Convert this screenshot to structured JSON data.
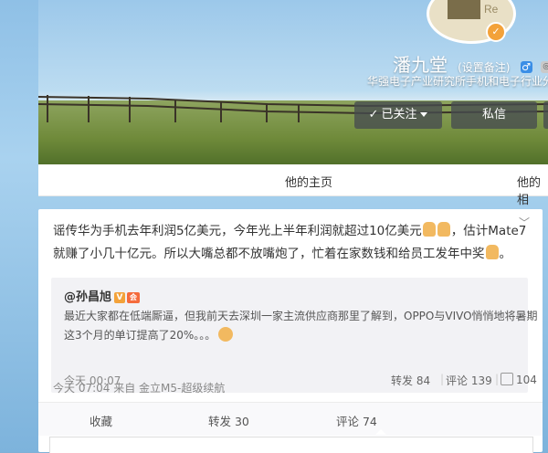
{
  "profile": {
    "avatar_text": "Re",
    "name": "潘九堂",
    "remark": "(设置备注)",
    "gender_icon": "♂",
    "subtitle": "华强电子产业研究所手机和电子行业分析师",
    "follow_label": "已关注",
    "message_label": "私信"
  },
  "nav": {
    "home": "他的主页",
    "second": "他的相"
  },
  "post": {
    "text_part1": "谣传华为手机去年利润5亿美元，今年光上半年利润就超过10亿美元",
    "text_part2": "，估计Mate7就赚了小几十亿元。所以大嘴总都不放嘴炮了，忙着在家数钱和给员工发年中奖",
    "text_part3": "。",
    "meta": "今天 07:04 来自 金立M5-超级续航",
    "quote": {
      "author": "@孙昌旭",
      "text": "最近大家都在低端厮逼，但我前天去深圳一家主流供应商那里了解到，OPPO与VIVO悄悄地将暑期这3个月的单订提高了20%。。。",
      "time": "今天 00:07",
      "repost": "转发 84",
      "comment": "评论 139",
      "like": "104"
    },
    "actions": {
      "collect": "收藏",
      "repost": "转发 30",
      "comment": "评论 74"
    }
  },
  "colors": {
    "accent_orange": "#f3a23a",
    "link_blue": "#3a8ee6"
  }
}
